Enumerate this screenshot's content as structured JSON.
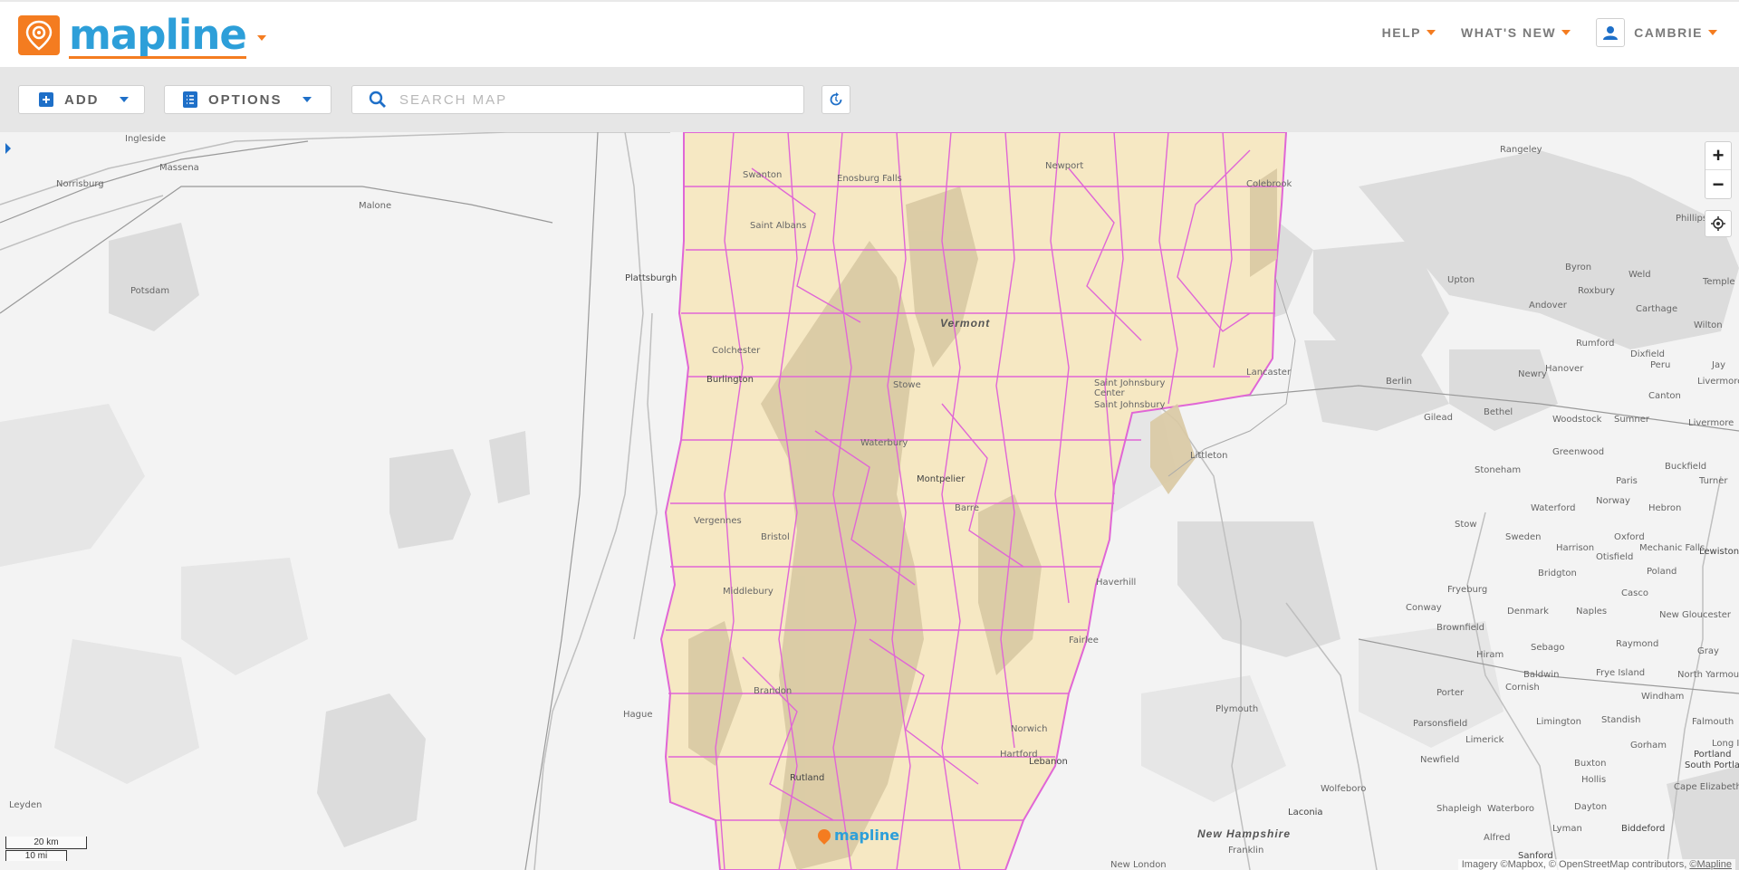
{
  "header": {
    "logo_text": "mapline",
    "nav": [
      {
        "label": "HELP"
      },
      {
        "label": "WHAT'S NEW"
      }
    ],
    "user": {
      "name": "CAMBRIE"
    }
  },
  "toolbar": {
    "add_label": "ADD",
    "options_label": "OPTIONS",
    "search_placeholder": "SEARCH MAP"
  },
  "map": {
    "state_labels": [
      "Vermont",
      "New Hampshire"
    ],
    "places": {
      "ingleside": "Ingleside",
      "norrisburg": "Norrisburg",
      "massena": "Massena",
      "malone": "Malone",
      "potsdam": "Potsdam",
      "plattsburgh": "Plattsburgh",
      "swanton": "Swanton",
      "enosburg": "Enosburg Falls",
      "stalbans": "Saint Albans",
      "newport": "Newport",
      "colebrook": "Colebrook",
      "colchester": "Colchester",
      "burlington": "Burlington",
      "stowe": "Stowe",
      "waterbury": "Waterbury",
      "montpelier": "Montpelier",
      "barre": "Barre",
      "stjcenter": "Saint Johnsbury Center",
      "stj": "Saint Johnsbury",
      "lancaster": "Lancaster",
      "littleton": "Littleton",
      "vergennes": "Vergennes",
      "bristol": "Bristol",
      "middlebury": "Middlebury",
      "brandon": "Brandon",
      "rutland": "Rutland",
      "hague": "Hague",
      "leyden": "Leyden",
      "bradford": "Haverhill",
      "fairlee": "Fairlee",
      "norwich": "Norwich",
      "hartford": "Hartford",
      "lebanon": "Lebanon",
      "plymouth": "Plymouth",
      "laconia": "Laconia",
      "franklin": "Franklin",
      "newlondon": "New London",
      "rangeley": "Rangeley",
      "phillips": "Phillips",
      "byron": "Byron",
      "upton": "Upton",
      "weld": "Weld",
      "temple": "Temple",
      "andover": "Andover",
      "roxbury": "Roxbury",
      "carthage": "Carthage",
      "rumford": "Rumford",
      "dixfield": "Dixfield",
      "wilton": "Wilton",
      "berlin": "Berlin",
      "hanover": "Hanover",
      "newry": "Newry",
      "peru": "Peru",
      "livermore": "Livermore",
      "jay": "Jay",
      "gilead": "Gilead",
      "bethel": "Bethel",
      "woodstock": "Woodstock",
      "sumner": "Sumner",
      "carton": "Canton",
      "livermore2": "Livermore",
      "greenwood": "Greenwood",
      "buckfield": "Buckfield",
      "stoneham": "Stoneham",
      "paris": "Paris",
      "turner": "Turner",
      "norway": "Norway",
      "hebron": "Hebron",
      "stow": "Stow",
      "waterford": "Waterford",
      "sweden": "Sweden",
      "oxford": "Oxford",
      "harrison": "Harrison",
      "mechanic": "Mechanic Falls",
      "lewiston": "Lewiston",
      "otisfield": "Otisfield",
      "poland": "Poland",
      "bridgton": "Bridgton",
      "fryeburg": "Fryeburg",
      "conway": "Conway",
      "casco": "Casco",
      "denmark": "Denmark",
      "naples": "Naples",
      "ngloucester": "New Gloucester",
      "brownfield": "Brownfield",
      "sebago": "Sebago",
      "raymond": "Raymond",
      "gray": "Gray",
      "hiram": "Hiram",
      "baldwin": "Baldwin",
      "fryeisland": "Frye Island",
      "nyarmouth": "North Yarmouth",
      "porter": "Porter",
      "cornish": "Cornish",
      "windham": "Windham",
      "falmouth": "Falmouth",
      "parsonsfield": "Parsonsfield",
      "limington": "Limington",
      "standish": "Standish",
      "limerick": "Limerick",
      "gorham": "Gorham",
      "longisland": "Long Is",
      "newfield": "Newfield",
      "buxton": "Buxton",
      "portland": "Portland",
      "soportland": "South Portlan",
      "hollis": "Hollis",
      "wolfeboro": "Wolfeboro",
      "capeelizabeth": "Cape Elizabeth",
      "shapleigh": "Shapleigh",
      "waterboro": "Waterboro",
      "dayton": "Dayton",
      "lyman": "Lyman",
      "biddeford": "Biddeford",
      "alfred": "Alfred",
      "sanford": "Sanford"
    },
    "scale": {
      "km": "20 km",
      "mi": "10 mi"
    },
    "watermark": "mapline",
    "attribution": "Imagery ©Mapbox, © OpenStreetMap contributors,",
    "attribution_link": "©Mapline"
  },
  "icons": {
    "add": "plus-square-icon",
    "options": "list-icon",
    "search": "magnifier-icon",
    "refresh": "refresh-icon",
    "user": "user-icon",
    "locate": "crosshair-icon"
  },
  "colors": {
    "brand_orange": "#f47c20",
    "brand_blue": "#2d9fd9",
    "territory_fill": "#f6e8c3",
    "territory_border": "#e066d6"
  }
}
